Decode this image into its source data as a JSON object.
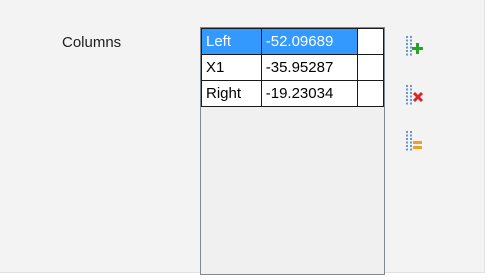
{
  "panel": {
    "label": "Columns"
  },
  "columns_table": {
    "selected_index": 0,
    "rows": [
      {
        "name": "Left",
        "value": "-52.09689"
      },
      {
        "name": "X1",
        "value": "-35.95287"
      },
      {
        "name": "Right",
        "value": "-19.23034"
      }
    ]
  },
  "buttons": [
    {
      "icon": "add-column-icon"
    },
    {
      "icon": "delete-column-icon"
    },
    {
      "icon": "align-columns-icon"
    }
  ],
  "colors": {
    "selection": "#3399ff",
    "add": "#2ca02c",
    "delete": "#d62728",
    "align": "#f0a020",
    "column_guide": "#3a78c8"
  }
}
